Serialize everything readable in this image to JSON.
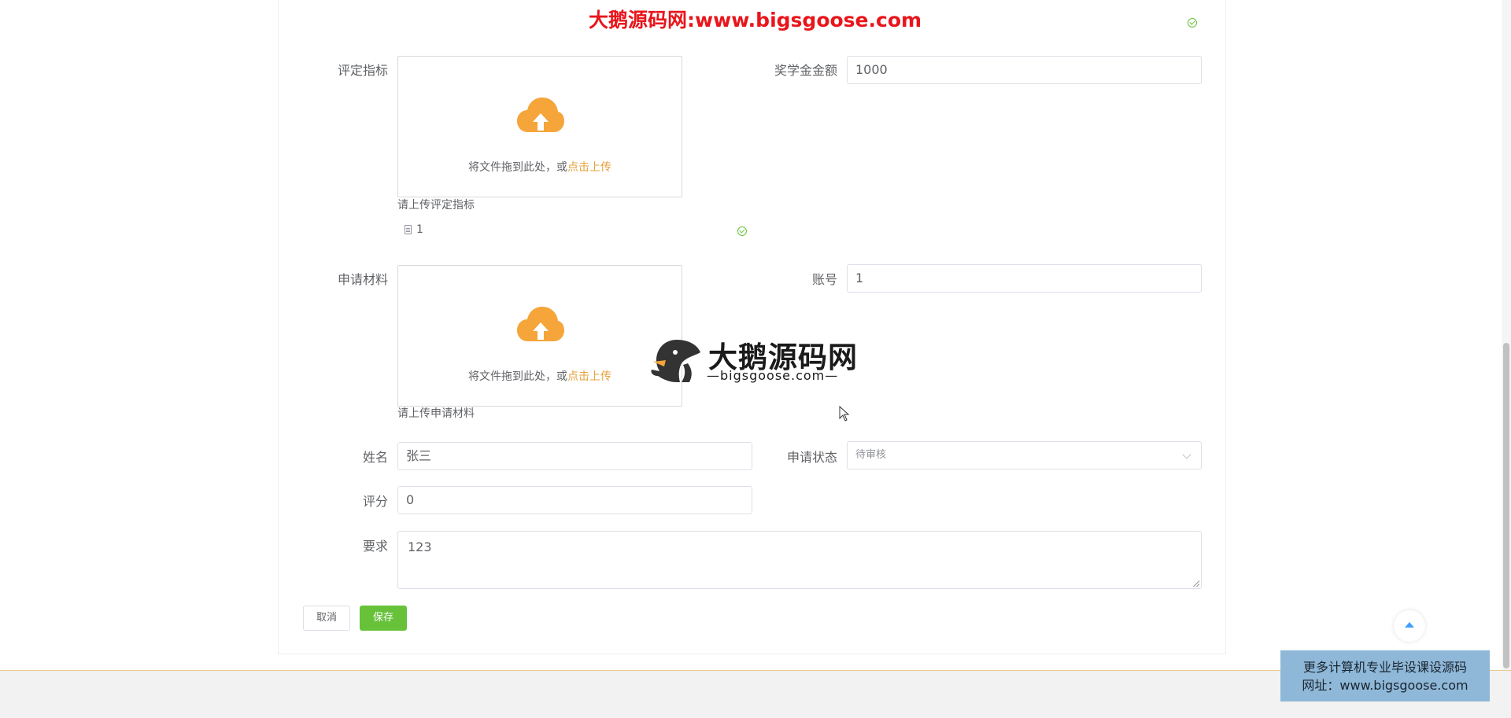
{
  "watermark": {
    "top_text": "大鹅源码网:www.bigsgoose.com",
    "logo_text": "大鹅源码网",
    "logo_sub": "—bigsgoose.com—"
  },
  "form": {
    "criteria": {
      "label": "评定指标",
      "upload_hint_prefix": "将文件拖到此处，或",
      "upload_hint_link": "点击上传",
      "tip": "请上传评定指标",
      "file_name": "1"
    },
    "scholarship_amount": {
      "label": "奖学金金额",
      "value": "1000"
    },
    "application_material": {
      "label": "申请材料",
      "upload_hint_prefix": "将文件拖到此处，或",
      "upload_hint_link": "点击上传",
      "tip": "请上传申请材料"
    },
    "account": {
      "label": "账号",
      "value": "1"
    },
    "name": {
      "label": "姓名",
      "value": "张三"
    },
    "application_status": {
      "label": "申请状态",
      "placeholder": "待审核"
    },
    "score": {
      "label": "评分",
      "value": "0"
    },
    "requirement": {
      "label": "要求",
      "value": "123"
    }
  },
  "buttons": {
    "cancel": "取消",
    "save": "保存"
  },
  "promo": {
    "line1": "更多计算机专业毕设课设源码",
    "line2": "网址：www.bigsgoose.com"
  },
  "colors": {
    "accent_orange": "#e6a23c",
    "success_green": "#67c23a",
    "watermark_red": "#e8151b",
    "back_top_blue": "#409eff"
  },
  "icons": [
    "upload-cloud-icon",
    "document-icon",
    "success-circle-icon",
    "chevron-down-icon",
    "arrow-up-icon",
    "goose-logo-icon",
    "cursor-arrow-icon"
  ]
}
